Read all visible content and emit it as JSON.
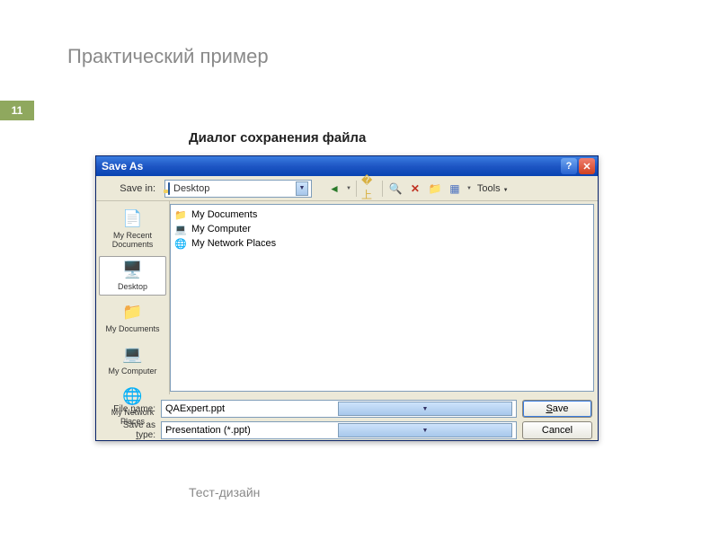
{
  "slide": {
    "title": "Практический пример",
    "number": "11",
    "subtitle": "Диалог сохранения файла",
    "footer": "Тест-дизайн"
  },
  "dialog": {
    "title": "Save As",
    "savein_label": "Save in:",
    "savein_value": "Desktop",
    "tools_label": "Tools",
    "places": [
      {
        "label": "My Recent Documents"
      },
      {
        "label": "Desktop"
      },
      {
        "label": "My Documents"
      },
      {
        "label": "My Computer"
      },
      {
        "label": "My Network Places"
      }
    ],
    "files": [
      {
        "label": "My Documents"
      },
      {
        "label": "My Computer"
      },
      {
        "label": "My Network Places"
      }
    ],
    "filename_label": "File name:",
    "filename_value": "QAExpert.ppt",
    "savetype_label": "Save as type:",
    "savetype_value": "Presentation (*.ppt)",
    "save_btn": "Save",
    "cancel_btn": "Cancel"
  }
}
